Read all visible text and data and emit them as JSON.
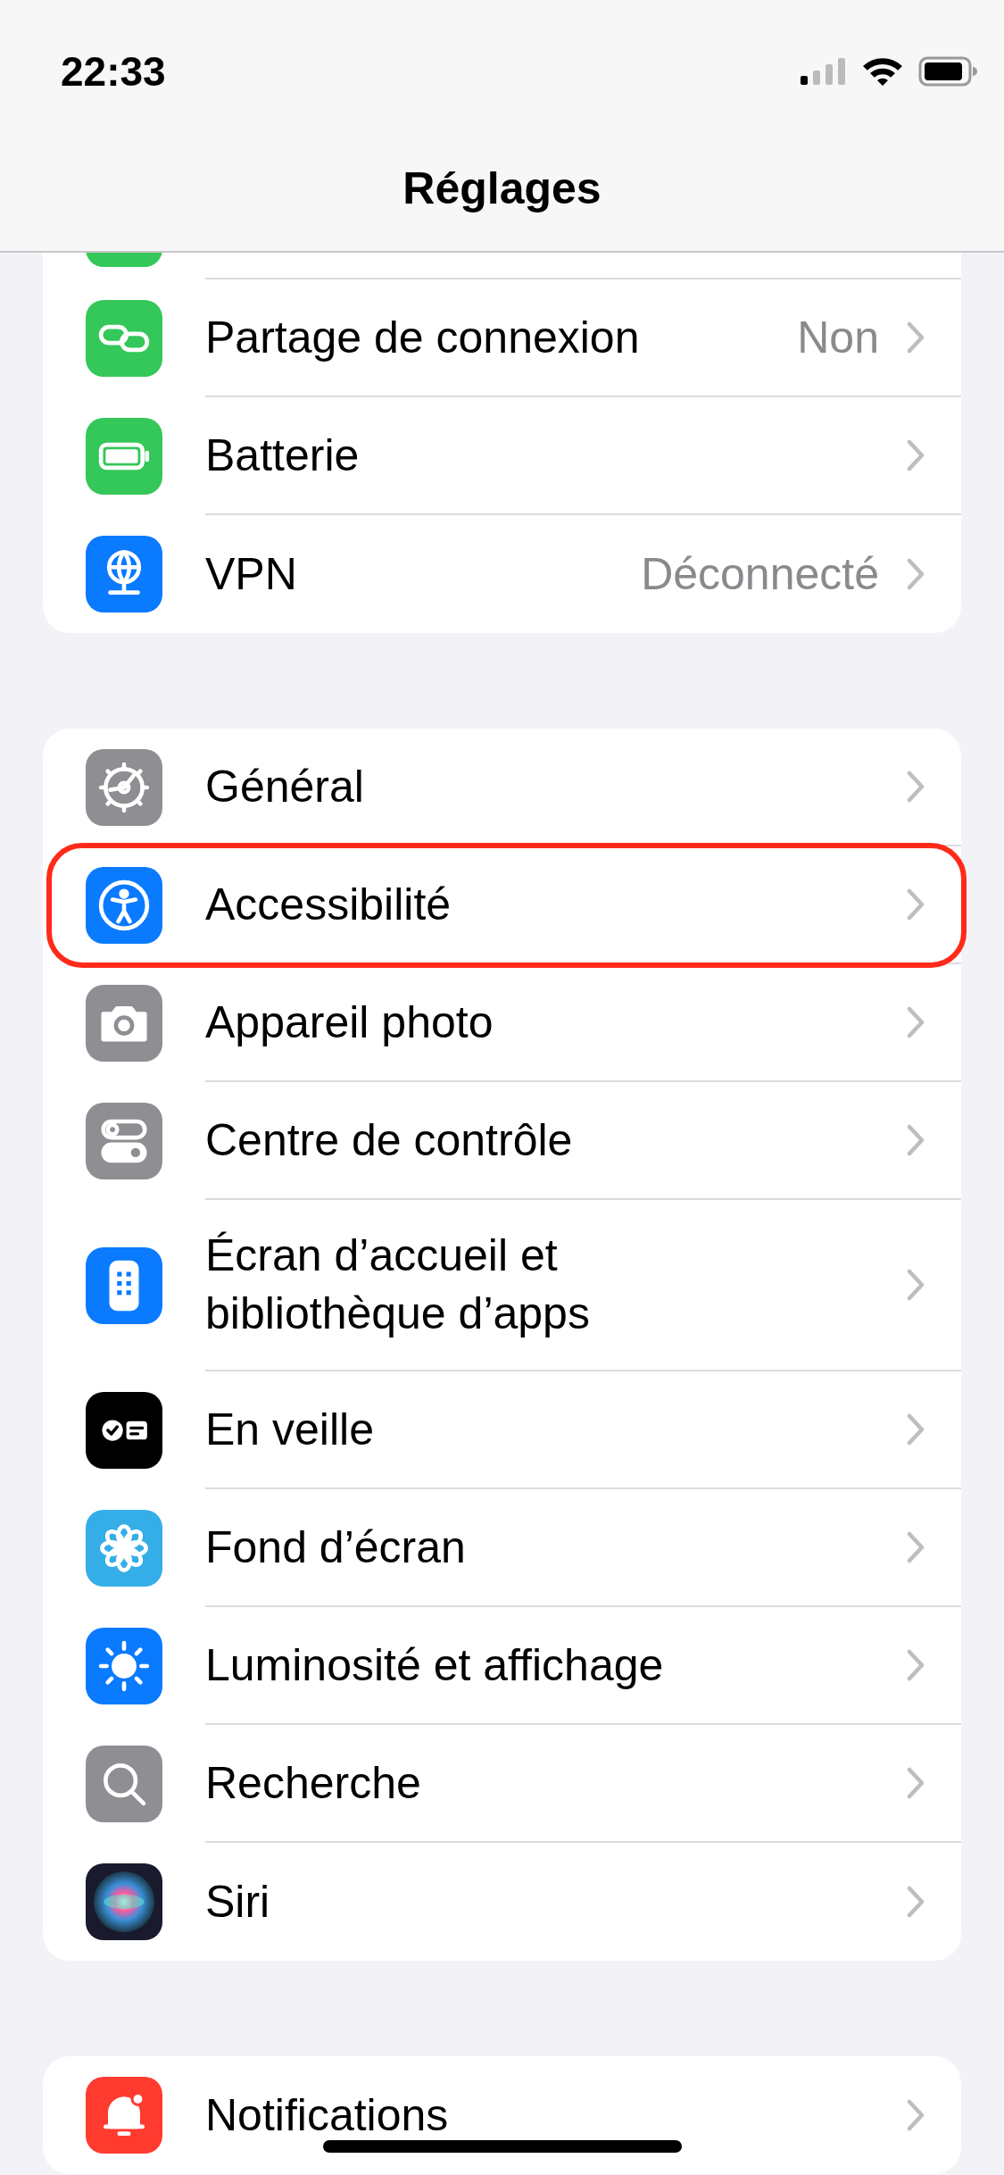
{
  "status_bar": {
    "time": "22:33"
  },
  "nav": {
    "title": "Réglages"
  },
  "groups": [
    {
      "items": [
        {
          "kind": "partial",
          "color": "#34c759"
        },
        {
          "kind": "row",
          "color": "#34c759",
          "label": "Partage de connexion",
          "value": "Non",
          "highlighted": false
        },
        {
          "kind": "row",
          "color": "#34c759",
          "label": "Batterie",
          "highlighted": false
        },
        {
          "kind": "row",
          "color": "#0a7aff",
          "label": "VPN",
          "value": "Déconnecté",
          "highlighted": false
        }
      ]
    },
    {
      "items": [
        {
          "kind": "row",
          "color": "#8e8e93",
          "label": "Général",
          "highlighted": false
        },
        {
          "kind": "row",
          "color": "#0a7aff",
          "label": "Accessibilité",
          "highlighted": true
        },
        {
          "kind": "row",
          "color": "#8e8e93",
          "label": "Appareil photo",
          "highlighted": false
        },
        {
          "kind": "row",
          "color": "#8e8e93",
          "label": "Centre de contrôle",
          "highlighted": false
        },
        {
          "kind": "row",
          "color": "#0a7aff",
          "label": "Écran d’accueil et\nbibliothèque d’apps",
          "highlighted": false
        },
        {
          "kind": "row",
          "color": "#000000",
          "label": "En veille",
          "highlighted": false
        },
        {
          "kind": "row",
          "color": "#35aee8",
          "label": "Fond d’écran",
          "highlighted": false
        },
        {
          "kind": "row",
          "color": "#0a7aff",
          "label": "Luminosité et affichage",
          "highlighted": false
        },
        {
          "kind": "row",
          "color": "#8e8e93",
          "label": "Recherche",
          "highlighted": false
        },
        {
          "kind": "row",
          "color": "#1a1a2e",
          "label": "Siri",
          "highlighted": false
        }
      ]
    },
    {
      "items": [
        {
          "kind": "row",
          "color": "#ff3b30",
          "label": "Notifications",
          "highlighted": false
        }
      ]
    }
  ]
}
